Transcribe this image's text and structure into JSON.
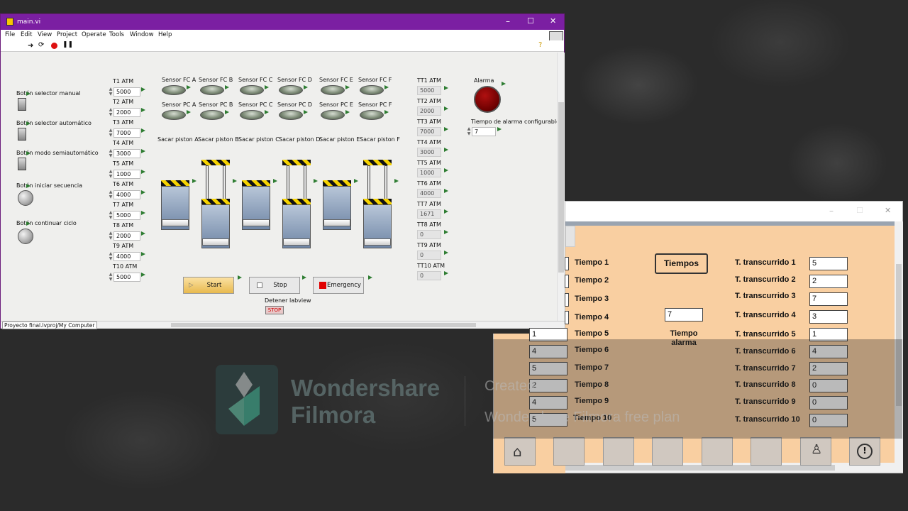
{
  "lv": {
    "title": "main.vi",
    "menu": [
      "File",
      "Edit",
      "View",
      "Project",
      "Operate",
      "Tools",
      "Window",
      "Help"
    ],
    "switches": [
      "Botón selector manual",
      "Botón selector automático",
      "Botón modo semiautomático",
      "Botón iniciar secuencia",
      "Botón continuar ciclo"
    ],
    "t_atm": [
      {
        "label": "T1 ATM",
        "value": "5000"
      },
      {
        "label": "T2 ATM",
        "value": "2000"
      },
      {
        "label": "T3 ATM",
        "value": "7000"
      },
      {
        "label": "T4 ATM",
        "value": "3000"
      },
      {
        "label": "T5 ATM",
        "value": "1000"
      },
      {
        "label": "T6 ATM",
        "value": "4000"
      },
      {
        "label": "T7 ATM",
        "value": "5000"
      },
      {
        "label": "T8 ATM",
        "value": "2000"
      },
      {
        "label": "T9 ATM",
        "value": "4000"
      },
      {
        "label": "T10 ATM",
        "value": "5000"
      }
    ],
    "sensors_fc": [
      "Sensor FC A",
      "Sensor FC B",
      "Sensor FC C",
      "Sensor FC D",
      "Sensor FC E",
      "Sensor FC F"
    ],
    "sensors_pc": [
      "Sensor PC A",
      "Sensor PC B",
      "Sensor PC C",
      "Sensor PC D",
      "Sensor PC E",
      "Sensor PC F"
    ],
    "pistons": [
      "Sacar piston A",
      "Sacar piston B",
      "Sacar piston C",
      "Sacar piston D",
      "Sacar piston E",
      "Sacar piston F"
    ],
    "tt_atm": [
      {
        "label": "TT1 ATM",
        "value": "5000"
      },
      {
        "label": "TT2 ATM",
        "value": "2000"
      },
      {
        "label": "TT3 ATM",
        "value": "7000"
      },
      {
        "label": "TT4 ATM",
        "value": "3000"
      },
      {
        "label": "TT5 ATM",
        "value": "1000"
      },
      {
        "label": "TT6 ATM",
        "value": "4000"
      },
      {
        "label": "TT7 ATM",
        "value": "1671"
      },
      {
        "label": "TT8 ATM",
        "value": "0"
      },
      {
        "label": "TT9 ATM",
        "value": "0"
      },
      {
        "label": "TT10 ATM",
        "value": "0"
      }
    ],
    "alarm_label": "Alarma",
    "alarm_time_label": "Tiempo de alarma configurable",
    "alarm_time_value": "7",
    "start": "Start",
    "stop": "Stop",
    "emergency": "Emergency",
    "stop_lv_label": "Detener labview",
    "stop_lv_btn": "STOP",
    "status": "Proyecto final.lvproj/My Computer"
  },
  "w2": {
    "tiempos_btn": "Tiempos",
    "tiempo_alarma_value": "7",
    "tiempo_alarma_label": "Tiempo alarma",
    "tiempo_labels": [
      "Tiempo 1",
      "Tiempo 2",
      "Tiempo 3",
      "Tiempo 4",
      "Tiempo 5",
      "Tiempo 6",
      "Tiempo 7",
      "Tiempo 8",
      "Tiempo 9",
      "Tiempo 10"
    ],
    "tiempo_values": [
      "",
      "",
      "",
      "",
      "1",
      "4",
      "5",
      "2",
      "4",
      "5"
    ],
    "tt_labels": [
      "T. transcurrido 1",
      "T. transcurrido 2",
      "T. transcurrido 3",
      "T. transcurrido 4",
      "T. transcurrido 5",
      "T. transcurrido 6",
      "T. transcurrido 7",
      "T. transcurrido 8",
      "T. transcurrido 9",
      "T. transcurrido 10"
    ],
    "tt_values": [
      "5",
      "2",
      "7",
      "3",
      "1",
      "4",
      "2",
      "0",
      "0",
      "0"
    ]
  },
  "watermark": {
    "brand1": "Wondershare",
    "brand2": "Filmora",
    "note1": "Created with",
    "note2": "Wondershare Filmora free plan"
  },
  "colors": {
    "lv_title": "#7b1fa2",
    "w2_bg": "#f9cfa1",
    "alarm": "#8b0000",
    "emergency": "#e00000"
  }
}
